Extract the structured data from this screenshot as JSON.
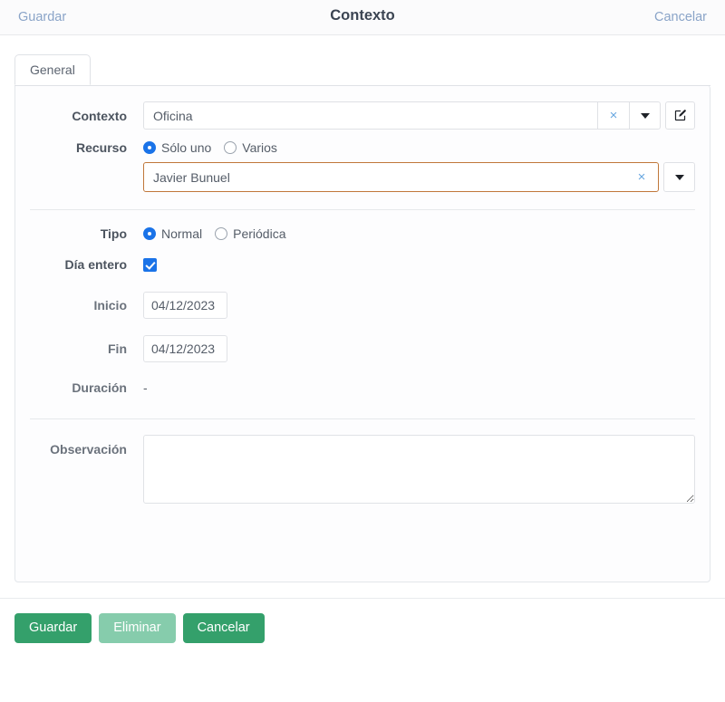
{
  "topbar": {
    "save_link": "Guardar",
    "title": "Contexto",
    "cancel_link": "Cancelar"
  },
  "tabs": [
    {
      "label": "General",
      "active": true
    }
  ],
  "form": {
    "contexto": {
      "label": "Contexto",
      "value": "Oficina",
      "clear_glyph": "×",
      "edit_icon": "edit-pencil-square-icon"
    },
    "recurso": {
      "label": "Recurso",
      "options": [
        {
          "label": "Sólo uno",
          "selected": true
        },
        {
          "label": "Varios",
          "selected": false
        }
      ],
      "value": "Javier Bunuel",
      "clear_glyph": "×"
    },
    "tipo": {
      "label": "Tipo",
      "options": [
        {
          "label": "Normal",
          "selected": true
        },
        {
          "label": "Periódica",
          "selected": false
        }
      ]
    },
    "dia_entero": {
      "label": "Día entero",
      "checked": true
    },
    "inicio": {
      "label": "Inicio",
      "value": "04/12/2023"
    },
    "fin": {
      "label": "Fin",
      "value": "04/12/2023"
    },
    "duracion": {
      "label": "Duración",
      "value": "-"
    },
    "observacion": {
      "label": "Observación",
      "value": "",
      "placeholder": ""
    }
  },
  "footer": {
    "save": "Guardar",
    "delete": "Eliminar",
    "cancel": "Cancelar"
  },
  "colors": {
    "accent_green": "#34a06b",
    "accent_green_muted": "#86ccac",
    "link_blue": "#8aa4c8",
    "control_blue": "#1a73e8",
    "highlight_border": "#c0773a"
  }
}
